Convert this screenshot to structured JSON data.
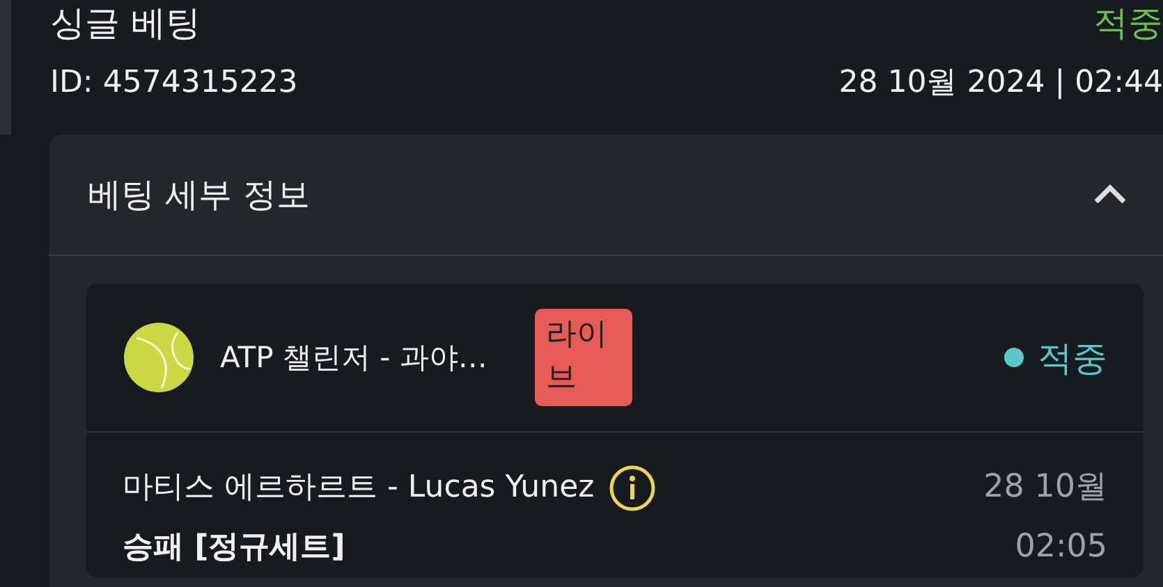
{
  "bet": {
    "title": "싱글 베팅",
    "status": "적중",
    "id": "ID: 4574315223",
    "datetime": "28 10월 2024 | 02:44"
  },
  "details": {
    "title": "베팅 세부 정보",
    "expanded": true,
    "selection": {
      "competition": "ATP 챌린저 - 과야…",
      "badge": "라이브",
      "status": "적중",
      "color": "#5bc8c8",
      "match": "마티스 에르하르트 - Lucas Yunez",
      "market": "승패 [정규세트]",
      "date": "28 10월",
      "time": "02:05"
    }
  }
}
